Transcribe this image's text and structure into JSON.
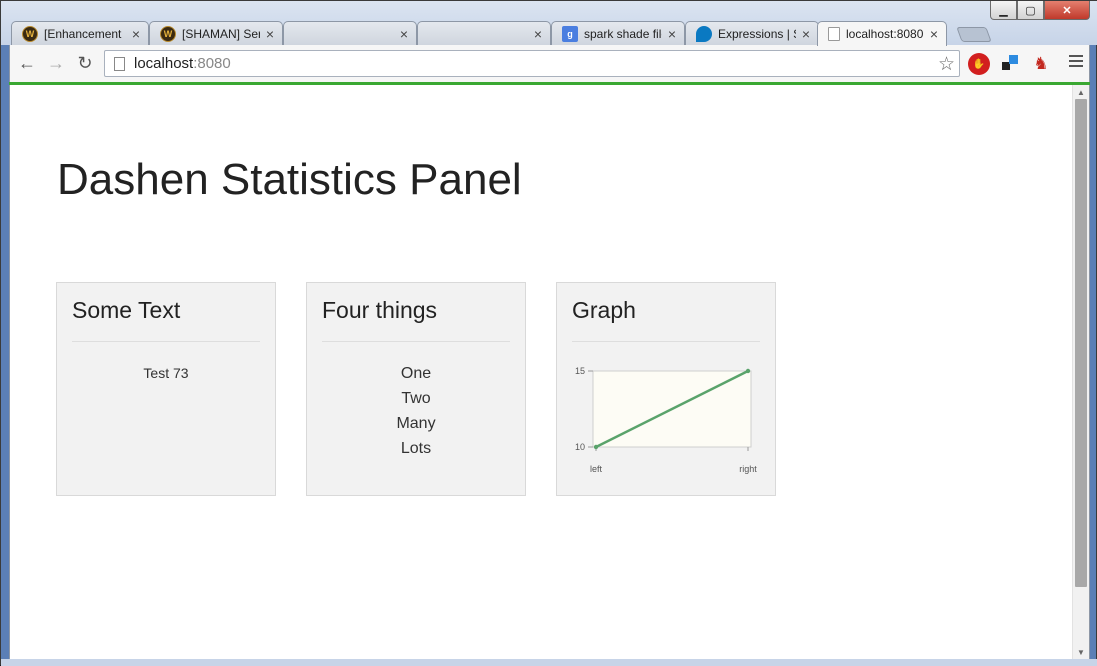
{
  "browser": {
    "tabs": [
      {
        "title": "[Enhancement",
        "favicon": "wow-icon"
      },
      {
        "title": "[SHAMAN] Ser",
        "favicon": "wow-icon"
      },
      {
        "title": "",
        "favicon": ""
      },
      {
        "title": "",
        "favicon": ""
      },
      {
        "title": "spark shade file",
        "favicon": "google-icon"
      },
      {
        "title": "Expressions | Sp",
        "favicon": "drupal-icon"
      },
      {
        "title": "localhost:8080",
        "favicon": "page-icon",
        "active": true
      }
    ],
    "address": {
      "host": "localhost",
      "port": ":8080"
    },
    "load_bar_color": "#3aa832"
  },
  "page": {
    "title": "Dashen Statistics Panel",
    "panels": {
      "text": {
        "heading": "Some Text",
        "body": "Test 73"
      },
      "things": {
        "heading": "Four things",
        "items": [
          "One",
          "Two",
          "Many",
          "Lots"
        ]
      },
      "graph": {
        "heading": "Graph"
      }
    }
  },
  "chart_data": {
    "type": "line",
    "categories": [
      "left",
      "right"
    ],
    "series": [
      {
        "values": [
          10,
          15
        ],
        "color": "#5aa36b"
      }
    ],
    "yticks": [
      "10",
      "15"
    ],
    "ylim": [
      10,
      15
    ],
    "plot_background": "#fdfcf5"
  }
}
